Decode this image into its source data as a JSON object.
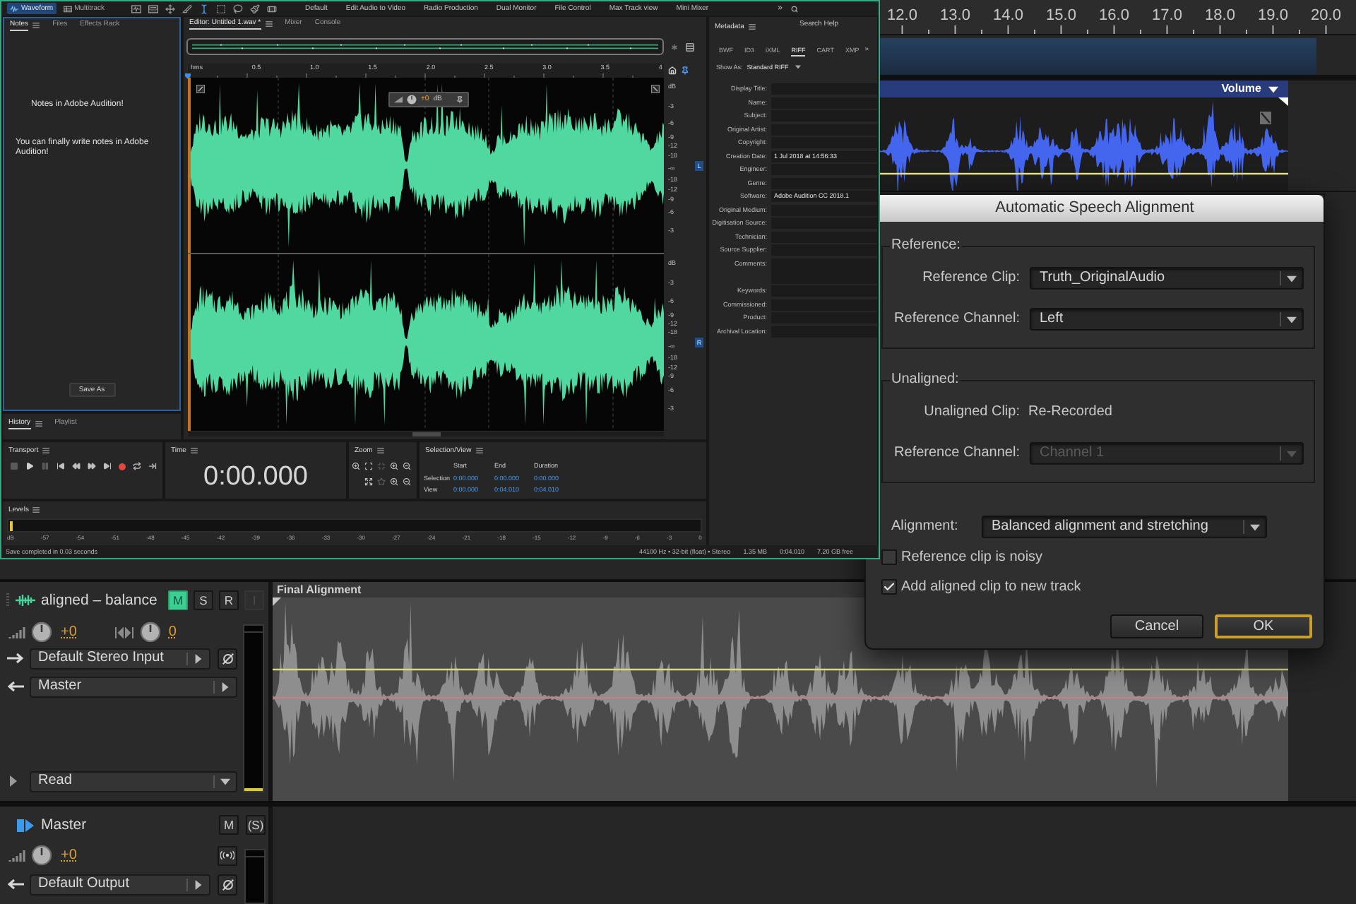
{
  "editor_window": {
    "modes": [
      {
        "kind": "waveform",
        "label": "Waveform",
        "selected": true
      },
      {
        "kind": "multitrack",
        "label": "Multitrack",
        "selected": false
      }
    ],
    "tools": [
      {
        "kind": "display",
        "selected": false
      },
      {
        "kind": "spectral",
        "selected": false
      },
      {
        "kind": "move",
        "selected": false
      },
      {
        "kind": "knife",
        "selected": false
      },
      {
        "kind": "ibeam",
        "selected": true
      },
      {
        "kind": "marquee",
        "selected": false
      },
      {
        "kind": "lasso",
        "selected": false
      },
      {
        "kind": "brush",
        "selected": false
      },
      {
        "kind": "healing",
        "selected": false
      }
    ],
    "workspaces": [
      "Default",
      "Edit Audio to Video",
      "Radio Production",
      "Dual Monitor",
      "File Control",
      "Max Track view",
      "Mini Mixer"
    ],
    "overflow": "»",
    "search": {
      "placeholder": "Search Help"
    },
    "notes_panel": {
      "tabs": [
        {
          "label": "Notes",
          "selected": true
        },
        {
          "label": "Files",
          "selected": false
        },
        {
          "label": "Effects Rack",
          "selected": false
        }
      ],
      "lines": [
        "Notes in Adobe Audition!",
        "You can finally write notes in Adobe Audition!"
      ],
      "save_button": "Save As"
    },
    "history_panel": {
      "tabs": [
        {
          "label": "History",
          "selected": true
        },
        {
          "label": "Playlist",
          "selected": false
        }
      ]
    },
    "editor": {
      "tabs": [
        {
          "label": "Editor: Untitled 1.wav *",
          "selected": true
        },
        {
          "label": "Mixer",
          "selected": false
        },
        {
          "label": "Console",
          "selected": false
        }
      ],
      "ruler": [
        "hms",
        "0.5",
        "1.0",
        "1.5",
        "2.0",
        "2.5",
        "3.0",
        "3.5",
        "4"
      ],
      "hud": {
        "gain": "+0",
        "unit": "dB"
      },
      "channels": [
        {
          "label": "L",
          "scale": [
            "dB",
            "-3",
            "-6",
            "-9",
            "-12",
            "-18",
            "-∞",
            "-18",
            "-12",
            "-9",
            "-6",
            "-3"
          ]
        },
        {
          "label": "R",
          "scale": [
            "dB",
            "-3",
            "-6",
            "-9",
            "-12",
            "-18",
            "-∞",
            "-18",
            "-12",
            "-9",
            "-6",
            "-3"
          ]
        }
      ]
    },
    "transport": {
      "title": "Transport"
    },
    "time": {
      "title": "Time",
      "value": "0:00.000"
    },
    "zoom": {
      "title": "Zoom"
    },
    "selection_view": {
      "title": "Selection/View",
      "columns": [
        "Start",
        "End",
        "Duration"
      ],
      "rows": [
        {
          "label": "Selection",
          "values": [
            "0:00.000",
            "0:00.000",
            "0:00.000"
          ]
        },
        {
          "label": "View",
          "values": [
            "0:00.000",
            "0:04.010",
            "0:04.010"
          ]
        }
      ]
    },
    "levels": {
      "title": "Levels",
      "scale": [
        "dB",
        "-57",
        "-54",
        "-51",
        "-48",
        "-45",
        "-42",
        "-39",
        "-36",
        "-33",
        "-30",
        "-27",
        "-24",
        "-21",
        "-18",
        "-15",
        "-12",
        "-9",
        "-6",
        "-3",
        "0"
      ]
    },
    "metadata": {
      "title": "Metadata",
      "tabs": [
        {
          "label": "BWF",
          "selected": false
        },
        {
          "label": "ID3",
          "selected": false
        },
        {
          "label": "iXML",
          "selected": false
        },
        {
          "label": "RIFF",
          "selected": true
        },
        {
          "label": "CART",
          "selected": false
        },
        {
          "label": "XMP",
          "selected": false
        }
      ],
      "overflow": "»",
      "show_as": {
        "label": "Show As:",
        "value": "Standard RIFF"
      },
      "fields": [
        {
          "kind": "line",
          "label": "Display Title:"
        },
        {
          "kind": "line",
          "label": "Name:"
        },
        {
          "kind": "line",
          "label": "Subject:"
        },
        {
          "kind": "line",
          "label": "Original Artist:"
        },
        {
          "kind": "line",
          "label": "Copyright:"
        },
        {
          "kind": "line",
          "label": "Creation Date:",
          "value": "1 Jul 2018 at 14:56:33"
        },
        {
          "kind": "line",
          "label": "Engineer:"
        },
        {
          "kind": "line",
          "label": "Genre:"
        },
        {
          "kind": "line",
          "label": "Software:",
          "value": "Adobe Audition CC 2018.1"
        },
        {
          "kind": "line",
          "label": "Original Medium:"
        },
        {
          "kind": "line",
          "label": "Digitisation Source:"
        },
        {
          "kind": "line",
          "label": "Technician:"
        },
        {
          "kind": "line",
          "label": "Source Supplier:"
        },
        {
          "kind": "area",
          "label": "Comments:"
        },
        {
          "kind": "line",
          "label": "Keywords:"
        },
        {
          "kind": "line",
          "label": "Commissioned:"
        },
        {
          "kind": "line",
          "label": "Product:"
        },
        {
          "kind": "line",
          "label": "Archival Location:"
        }
      ]
    },
    "status_bar": {
      "message": "Save completed in 0.03 seconds",
      "items": [
        "44100 Hz • 32-bit (float) • Stereo",
        "1.35 MB",
        "0:04.010",
        "7.20 GB free"
      ]
    }
  },
  "dialog": {
    "title": "Automatic Speech Alignment",
    "groups": [
      {
        "title": "Reference:",
        "rows": [
          {
            "kind": "dropdown",
            "label": "Reference Clip:",
            "value": "Truth_OriginalAudio",
            "disabled": false
          },
          {
            "kind": "dropdown",
            "label": "Reference Channel:",
            "value": "Left",
            "disabled": false
          }
        ]
      },
      {
        "title": "Unaligned:",
        "rows": [
          {
            "kind": "text",
            "label": "Unaligned Clip:",
            "value": "Re-Recorded"
          },
          {
            "kind": "dropdown",
            "label": "Reference Channel:",
            "value": "Channel 1",
            "disabled": true
          }
        ]
      }
    ],
    "alignment": {
      "label": "Alignment:",
      "value": "Balanced alignment and stretching"
    },
    "checkboxes": [
      {
        "label": "Reference clip is noisy",
        "checked": false
      },
      {
        "label": "Add aligned clip to new track",
        "checked": true
      }
    ],
    "buttons": [
      {
        "label": "Cancel",
        "default": false
      },
      {
        "label": "OK",
        "default": true
      }
    ]
  },
  "multitrack": {
    "ruler": [
      "12.0",
      "13.0",
      "14.0",
      "15.0",
      "16.0",
      "17.0",
      "18.0",
      "19.0",
      "20.0"
    ],
    "top_clip": {
      "envelope": "Volume"
    },
    "tracks": [
      {
        "kind": "audio",
        "name": "aligned – balance",
        "buttons": [
          {
            "label": "M",
            "on": true,
            "disabled": false
          },
          {
            "label": "S",
            "on": false,
            "disabled": false
          },
          {
            "label": "R",
            "on": false,
            "disabled": false
          },
          {
            "label": "I",
            "on": false,
            "disabled": true
          }
        ],
        "volume": "+0",
        "pan": "0",
        "input": "Default Stereo Input",
        "output": "Master",
        "automation": "Read",
        "clip": {
          "title": "Final Alignment"
        }
      },
      {
        "kind": "master",
        "name": "Master",
        "buttons": [
          {
            "label": "M",
            "on": false,
            "disabled": false
          },
          {
            "label": "(S)",
            "on": false,
            "disabled": false
          }
        ],
        "volume": "+0",
        "output": "Default Output"
      }
    ]
  }
}
